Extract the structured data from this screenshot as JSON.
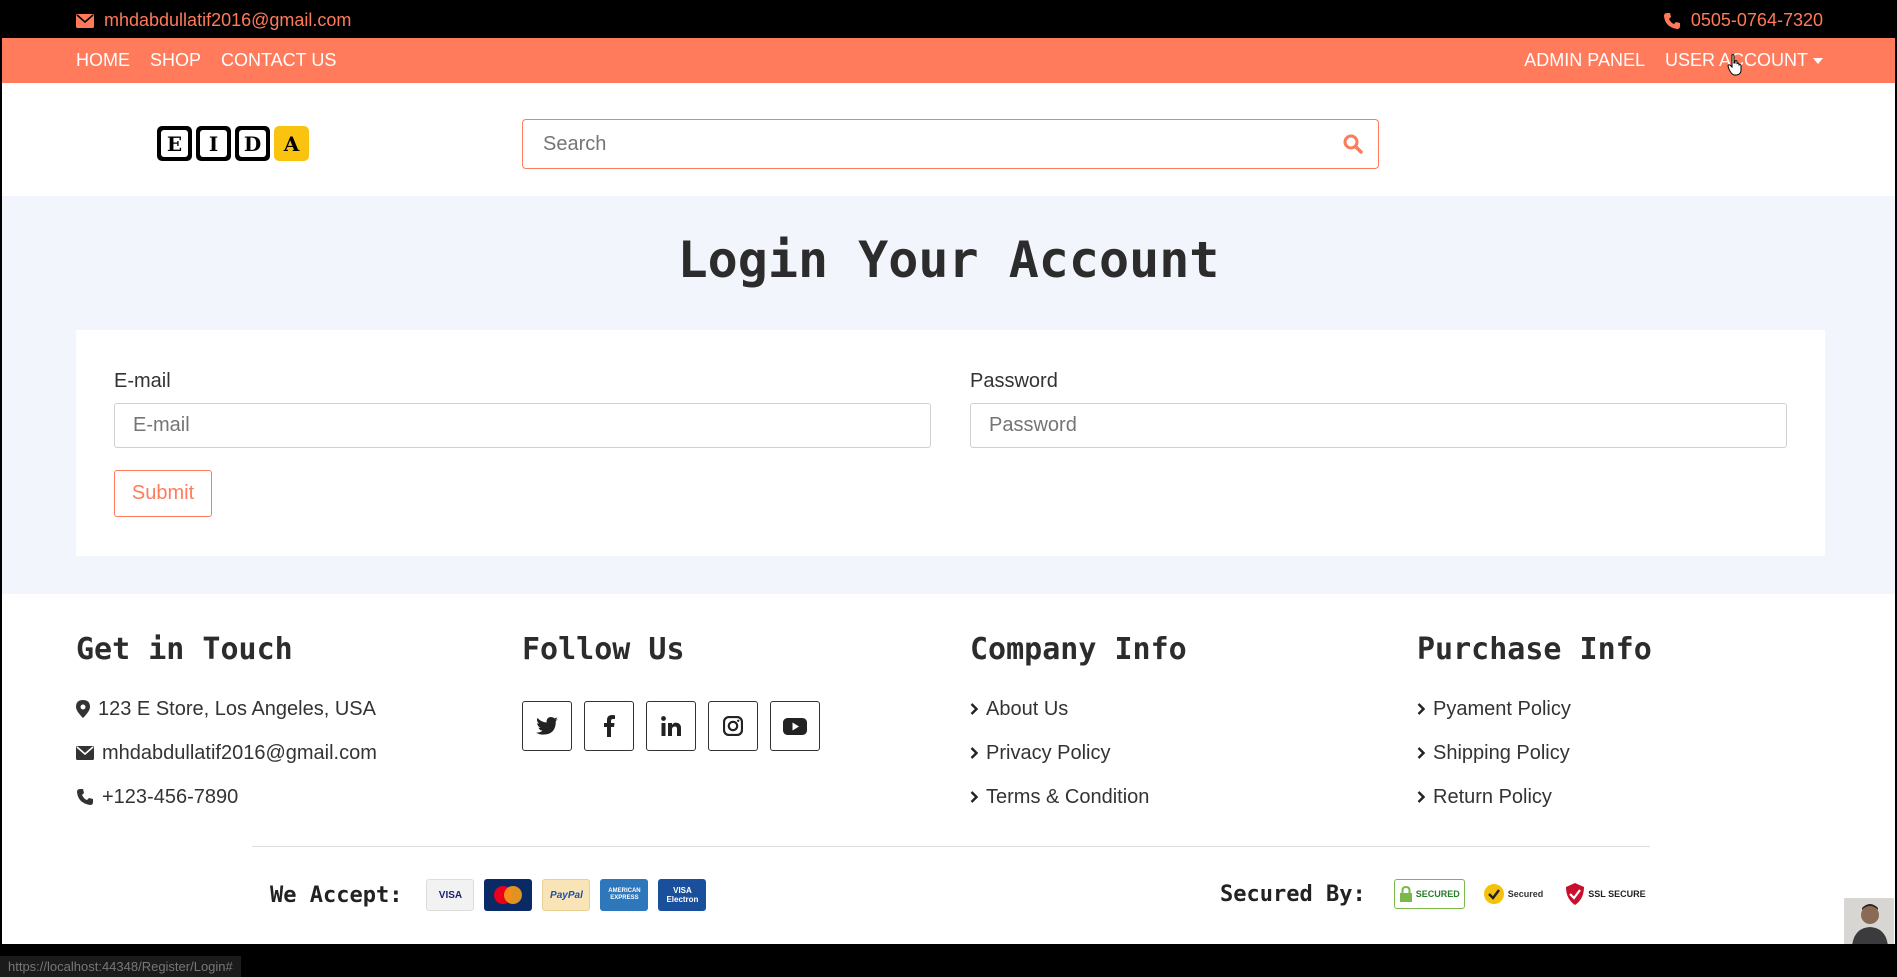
{
  "topbar": {
    "email": "mhdabdullatif2016@gmail.com",
    "phone": "0505-0764-7320"
  },
  "nav": {
    "left": [
      "HOME",
      "SHOP",
      "CONTACT US"
    ],
    "admin": "ADMIN PANEL",
    "user": "USER ACCOUNT"
  },
  "logo": {
    "letters": [
      "E",
      "I",
      "D",
      "A"
    ]
  },
  "search": {
    "placeholder": "Search"
  },
  "login": {
    "title": "Login Your Account",
    "email_label": "E-mail",
    "email_placeholder": "E-mail",
    "password_label": "Password",
    "password_placeholder": "Password",
    "submit": "Submit"
  },
  "footer": {
    "touch": {
      "title": "Get in Touch",
      "address": "123 E Store, Los Angeles, USA",
      "email": "mhdabdullatif2016@gmail.com",
      "phone": "+123-456-7890"
    },
    "follow": {
      "title": "Follow Us",
      "icons": [
        "twitter-icon",
        "facebook-icon",
        "linkedin-icon",
        "instagram-icon",
        "youtube-icon"
      ]
    },
    "company": {
      "title": "Company Info",
      "links": [
        "About Us",
        "Privacy Policy",
        "Terms & Condition"
      ]
    },
    "purchase": {
      "title": "Purchase Info",
      "links": [
        "Pyament Policy",
        "Shipping Policy",
        "Return Policy"
      ]
    },
    "accept_label": "We Accept:",
    "secured_label": "Secured By:",
    "cards": [
      "VISA",
      "MasterCard",
      "PayPal",
      "AMERICAN EXPRESS",
      "VISA Electron"
    ],
    "seals": [
      "SECURED",
      "Secured",
      "SSL SECURE"
    ]
  },
  "status_url": "https://localhost:44348/Register/Login#",
  "colors": {
    "accent": "#ff7b5c",
    "topbar": "#000000",
    "section_bg": "#f2f6fc"
  }
}
